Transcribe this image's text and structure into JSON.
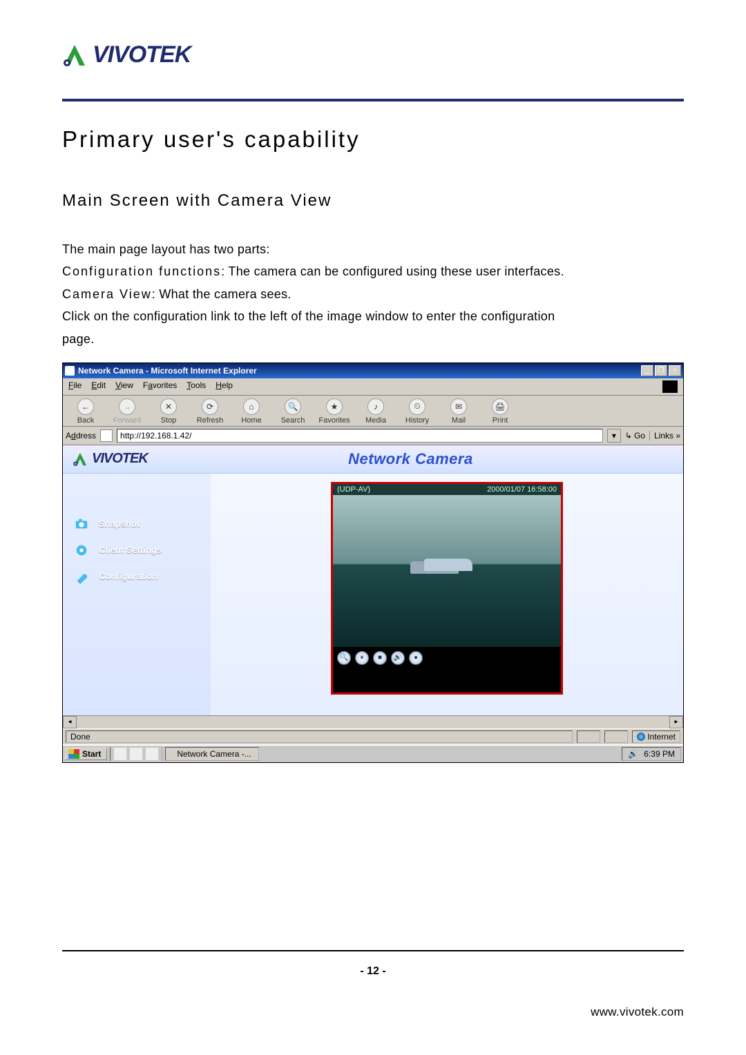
{
  "brand": "VIVOTEK",
  "heading": "Primary user's capability",
  "subheading": "Main Screen with Camera View",
  "intro_lines": [
    "The main page layout has two parts:"
  ],
  "config_kw": "Configuration functions",
  "config_txt": ": The camera can be configured using these user interfaces.",
  "view_kw": "Camera View",
  "view_txt": ": What the camera sees.",
  "more1": "Click on the configuration link to the left of the image window to enter the configuration",
  "more2": "page.",
  "ie": {
    "title": "Network Camera - Microsoft Internet Explorer",
    "menus": [
      "File",
      "Edit",
      "View",
      "Favorites",
      "Tools",
      "Help"
    ],
    "toolbar": [
      "Back",
      "Forward",
      "Stop",
      "Refresh",
      "Home",
      "Search",
      "Favorites",
      "Media",
      "History",
      "Mail",
      "Print"
    ],
    "toolbar_disabled": [
      1
    ],
    "addr_label": "Address",
    "url": "http://192.168.1.42/",
    "go": "Go",
    "links": "Links",
    "status_done": "Done",
    "status_zone": "Internet"
  },
  "app": {
    "brand": "VIVOTEK",
    "title": "Network Camera",
    "sidebar": [
      {
        "label": "Snapshot",
        "icon": "camera-icon"
      },
      {
        "label": "Client Settings",
        "icon": "gear-icon"
      },
      {
        "label": "Configuration",
        "icon": "wrench-icon"
      }
    ],
    "cam_proto": "(UDP-AV)",
    "cam_time": "2000/01/07 16:58:00",
    "cam_btns": [
      "zoom-icon",
      "pause-icon",
      "stop-icon",
      "audio-icon",
      "record-icon"
    ]
  },
  "taskbar": {
    "start": "Start",
    "task": "Network Camera -...",
    "time": "6:39 PM"
  },
  "page_num": "- 12 -",
  "footer_url": "www.vivotek.com"
}
